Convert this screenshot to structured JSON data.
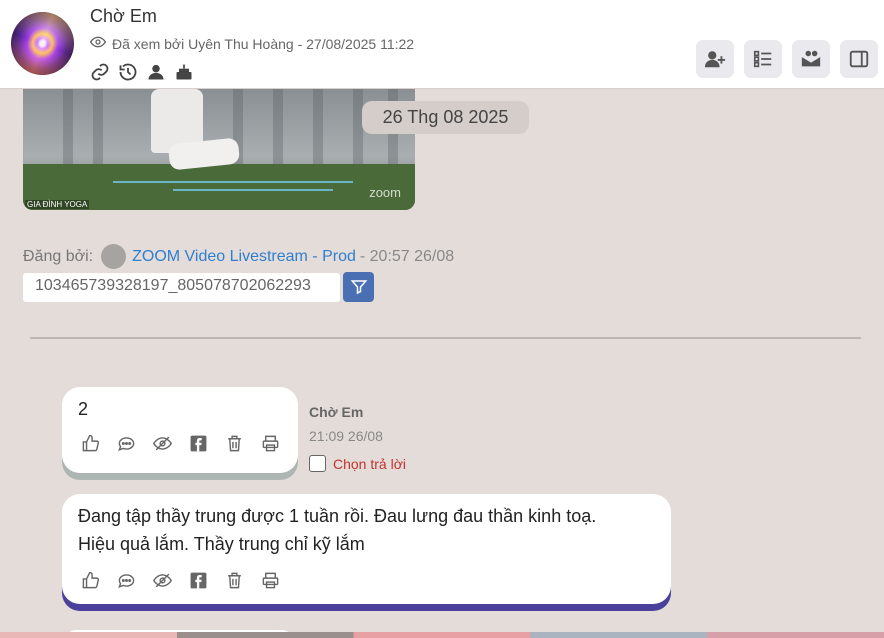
{
  "header": {
    "chat_name": "Chờ Em",
    "seen_text": "Đã xem bởi Uyên Thu Hoàng - 27/08/2025 11:22",
    "icons": [
      "link-icon",
      "history-icon",
      "user-icon",
      "birthday-cake-icon"
    ],
    "buttons": [
      "add-user-icon",
      "list-icon",
      "mail-group-icon",
      "sidebar-toggle-icon"
    ]
  },
  "media": {
    "watermark": "zoom",
    "brand_label": "GIA ĐÌNH YOGA"
  },
  "date_chip": "26 Thg 08 2025",
  "post": {
    "posted_by_label": "Đăng bởi:",
    "source_name": "ZOOM Video Livestream - Prod",
    "posted_time": "- 20:57 26/08",
    "id_value": "103465739328197_805078702062293"
  },
  "messages": [
    {
      "text": "2",
      "author": "Chờ Em",
      "time": "21:09 26/08",
      "reply_label": "Chọn trả lời"
    },
    {
      "line1": "Đang tập thầy trung được  1 tuần rồi. Đau lưng đau thần kinh toạ.",
      "line2": "Hiệu quả lắm. Thầy trung chỉ kỹ lắm"
    }
  ],
  "colors": {
    "accent_blue": "#4a6fb3",
    "link_blue": "#2f7fd1",
    "reply_red": "#c3332f",
    "bubble_underline_purple": "#4b3f9c"
  }
}
